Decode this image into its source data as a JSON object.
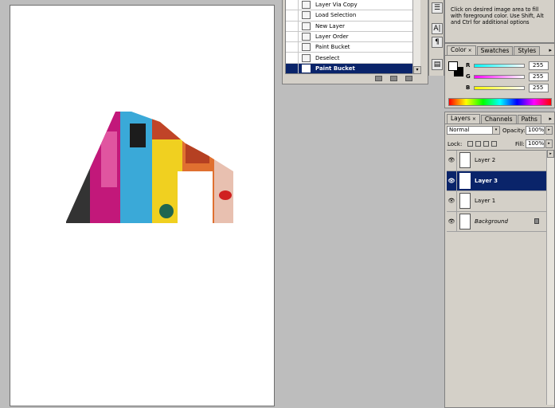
{
  "history": {
    "items": [
      {
        "label": "Layer Via Copy",
        "selected": false
      },
      {
        "label": "Load Selection",
        "selected": false
      },
      {
        "label": "New Layer",
        "selected": false
      },
      {
        "label": "Layer Order",
        "selected": false
      },
      {
        "label": "Paint Bucket",
        "selected": false
      },
      {
        "label": "Deselect",
        "selected": false
      },
      {
        "label": "Paint Bucket",
        "selected": true
      }
    ],
    "scroll_arrow": "▾"
  },
  "hint": {
    "text": "Click on desired image area to fill with foreground color.  Use Shift, Alt and Ctrl for additional options"
  },
  "color_panel": {
    "tabs": [
      {
        "label": "Color",
        "active": true,
        "close": "×"
      },
      {
        "label": "Swatches",
        "active": false
      },
      {
        "label": "Styles",
        "active": false
      }
    ],
    "menu_glyph": "▸",
    "close_glyph": "×",
    "foreground": "#ffffff",
    "background": "#000000",
    "channels": [
      {
        "label": "R",
        "value": "255",
        "gradient": "linear-gradient(to right,#00ffff,#ffffff)"
      },
      {
        "label": "G",
        "value": "255",
        "gradient": "linear-gradient(to right,#ff00ff,#ffffff)"
      },
      {
        "label": "B",
        "value": "255",
        "gradient": "linear-gradient(to right,#ffff00,#ffffff)"
      }
    ]
  },
  "layers_panel": {
    "tabs": [
      {
        "label": "Layers",
        "active": true,
        "close": "×"
      },
      {
        "label": "Channels",
        "active": false
      },
      {
        "label": "Paths",
        "active": false
      }
    ],
    "menu_glyph": "▸",
    "close_glyph": "×",
    "blend_mode": "Normal",
    "opacity_label": "Opacity:",
    "opacity_value": "100%",
    "lock_label": "Lock:",
    "fill_label": "Fill:",
    "fill_value": "100%",
    "dropdown_glyph": "▾",
    "arrow_glyph": "▸",
    "eye_glyph": "👁",
    "layers": [
      {
        "name": "Layer 2",
        "selected": false,
        "italic": false,
        "locked": false
      },
      {
        "name": "Layer 3",
        "selected": true,
        "italic": false,
        "locked": false
      },
      {
        "name": "Layer 1",
        "selected": false,
        "italic": false,
        "locked": false
      },
      {
        "name": "Background",
        "selected": false,
        "italic": true,
        "locked": true
      }
    ]
  },
  "strip": {
    "buttons": [
      "☰",
      "A|",
      "¶",
      "▤"
    ]
  },
  "colors": {
    "selection": "#0a246a",
    "panel": "#d4d0c8",
    "workspace": "#bdbdbd"
  }
}
